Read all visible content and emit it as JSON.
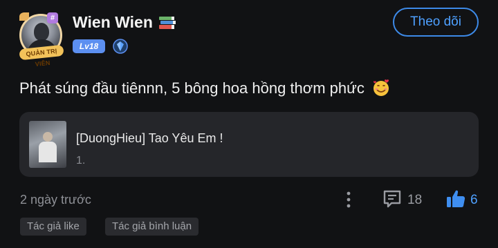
{
  "author": {
    "name": "Wien Wien",
    "level": "Lv18",
    "avatar_ribbon": "QUẢN TRỊ VIÊN",
    "avatar_badge": "#"
  },
  "follow_button": "Theo dõi",
  "post": {
    "text": "Phát súng đầu tiênnn, 5 bông hoa hồng thơm phức"
  },
  "song_card": {
    "title": "[DuongHieu] Tao Yêu Em !",
    "index": "1."
  },
  "footer": {
    "time_ago": "2 ngày trước",
    "comment_count": "18",
    "like_count": "6"
  },
  "tags": [
    "Tác giả like",
    "Tác giả bình luận"
  ],
  "colors": {
    "background": "#111214",
    "accent": "#4ea0ff",
    "card": "#25262a",
    "level_badge": "#5c8ff0"
  },
  "icons": [
    "books-emoji-icon",
    "shield-icon",
    "smiling-hearts-emoji-icon",
    "more-vertical-icon",
    "comment-icon",
    "thumbs-up-icon"
  ]
}
